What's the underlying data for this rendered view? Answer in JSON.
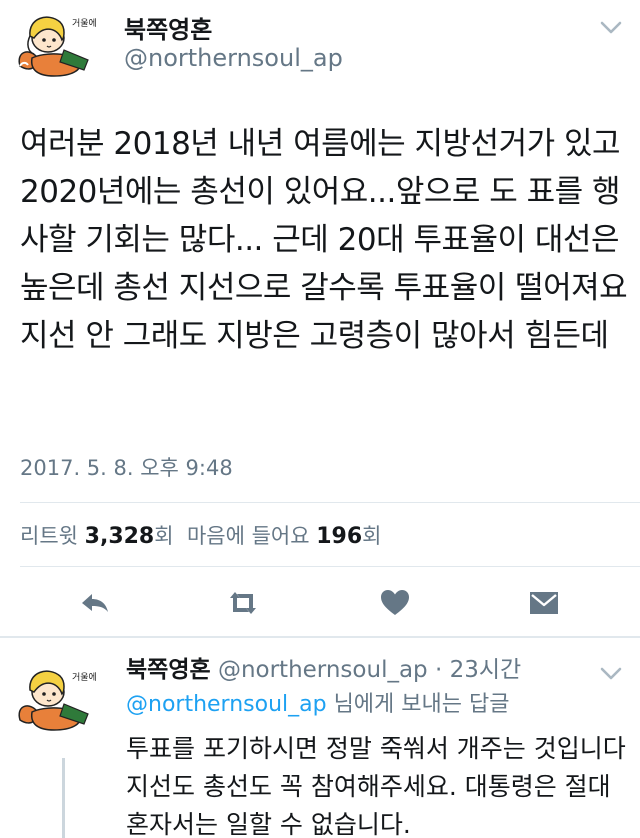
{
  "tweet": {
    "author_name": "북쪽영혼",
    "author_handle": "@northernsoul_ap",
    "text": "여러분 2018년 내년 여름에는 지방선거가 있고 2020년에는 총선이 있어요...앞으로 도 표를 행사할 기회는 많다... 근데 20대 투표율이 대선은 높은데 총선 지선으로 갈수록 투표율이 떨어져요 지선 안 그래도 지방은 고령층이 많아서 힘든데",
    "timestamp": "2017. 5. 8. 오후 9:48",
    "avatar_sticker_text": "거울에",
    "stats": {
      "retweet_label": "리트윗",
      "retweet_count": "3,328",
      "retweet_unit": "회",
      "like_label": "마음에 들어요",
      "like_count": "196",
      "like_unit": "회"
    }
  },
  "actions": {
    "icons": [
      "reply-icon",
      "retweet-icon",
      "like-icon",
      "dm-icon"
    ]
  },
  "reply": {
    "author_name": "북쪽영혼",
    "meta": "@northernsoul_ap · 23시간",
    "replying_to_handle": "@northernsoul_ap",
    "replying_to_suffix": " 님에게 보내는 답글",
    "text": "투표를 포기하시면 정말 죽쒀서 개주는 것입니다 지선도 총선도 꼭 참여해주세요. 대통령은 절대 혼자서는 일할 수 없습니다.",
    "avatar_sticker_text": "거울에"
  },
  "colors": {
    "text_primary": "#14171a",
    "text_secondary": "#657786",
    "link": "#1da1f2",
    "icon": "#657786",
    "divider": "#e1e8ed"
  }
}
